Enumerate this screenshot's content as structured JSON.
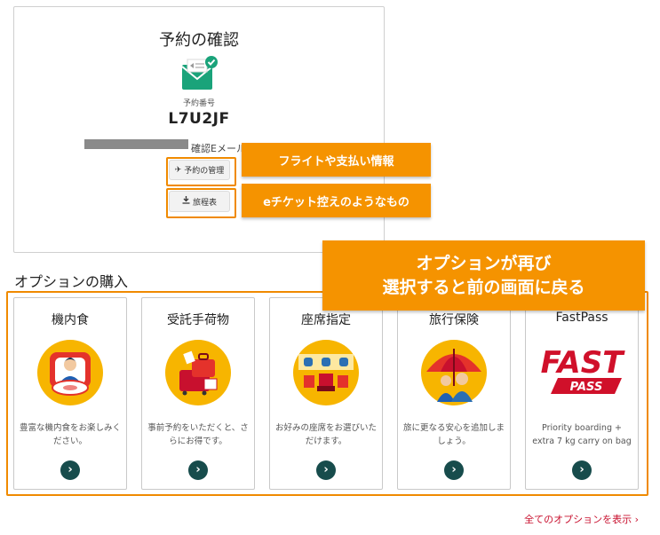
{
  "confirmation": {
    "title": "予約の確認",
    "booking_number_label": "予約番号",
    "booking_number": "L7U2JF",
    "email_text": "確認Eメール",
    "manage_button": "予約の管理",
    "itinerary_button": "旅程表"
  },
  "callouts": {
    "manage_note": "フライトや支払い情報",
    "itinerary_note": "eチケット控えのようなもの",
    "options_note_line1": "オプションが再び",
    "options_note_line2": "選択すると前の画面に戻る"
  },
  "options": {
    "section_title": "オプションの購入",
    "items": [
      {
        "name": "機内食",
        "desc": "豊富な機内食をお楽しみください。",
        "icon": "meal-icon"
      },
      {
        "name": "受託手荷物",
        "desc": "事前予約をいただくと、さらにお得です。",
        "icon": "baggage-icon"
      },
      {
        "name": "座席指定",
        "desc": "お好みの座席をお選びいただけます。",
        "icon": "seat-icon"
      },
      {
        "name": "旅行保険",
        "desc": "旅に更なる安心を追加しましょう。",
        "icon": "insurance-icon"
      },
      {
        "name": "FastPass",
        "desc": "Priority boarding + extra 7 kg carry on bag",
        "icon": "fastpass-logo"
      }
    ],
    "logo_text_top": "FAST",
    "logo_text_bottom": "PASS",
    "arrow": "›",
    "all_link": "全てのオプションを表示",
    "all_link_arrow": "›"
  },
  "colors": {
    "highlight": "#f08a00",
    "callout": "#f59300",
    "arrow_button": "#174c4c",
    "link": "#c8102e",
    "envelope": "#1aa37a"
  }
}
